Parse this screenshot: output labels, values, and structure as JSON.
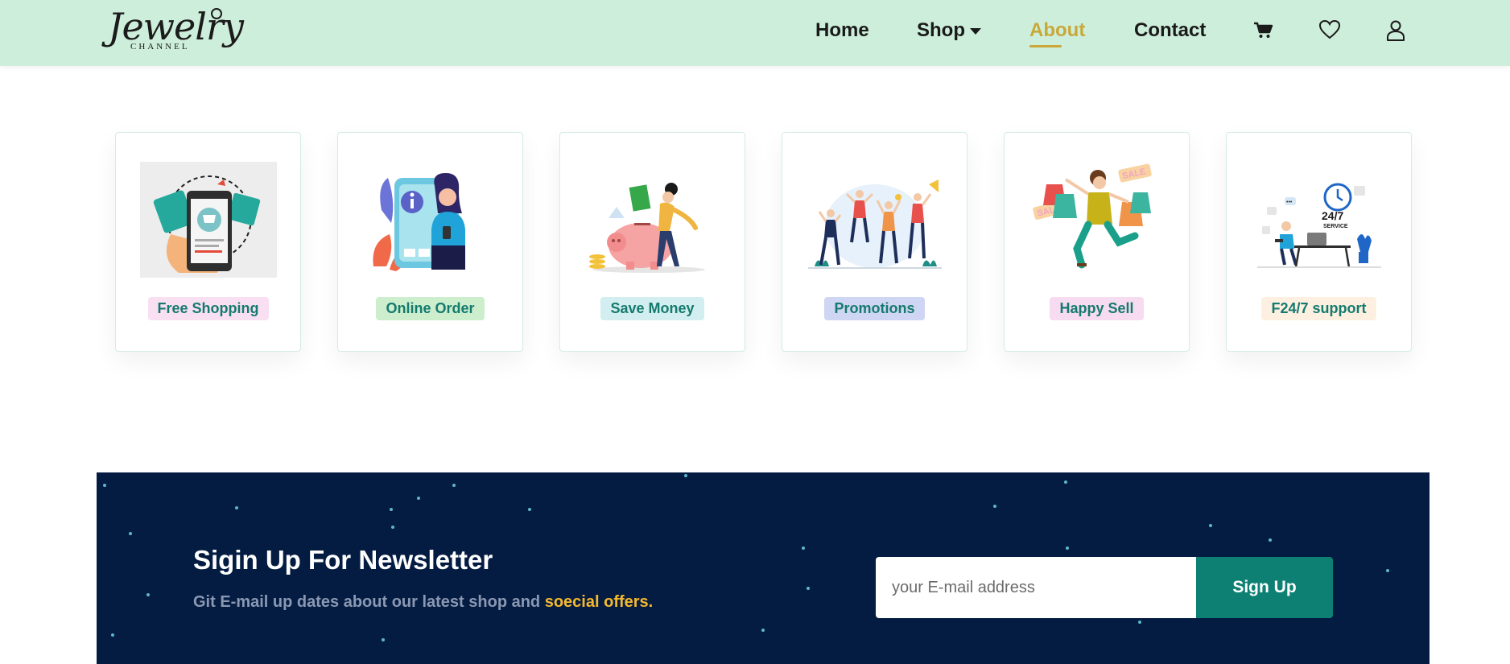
{
  "brand": {
    "logo_script": "Jewelry",
    "logo_sub": "CHANNEL"
  },
  "nav": {
    "items": [
      {
        "label": "Home"
      },
      {
        "label": "Shop"
      },
      {
        "label": "About"
      },
      {
        "label": "Contact"
      }
    ],
    "active": "About",
    "active_color": "#c9a83a",
    "icons": [
      "cart-icon",
      "heart-icon",
      "user-icon"
    ]
  },
  "features": [
    {
      "label": "Free Shopping",
      "badge_color": "#f9dff2",
      "icon": "shopping-phone-icon"
    },
    {
      "label": "Online Order",
      "badge_color": "#cdeecd",
      "icon": "online-order-icon"
    },
    {
      "label": "Save Money",
      "badge_color": "#d2eef0",
      "icon": "piggy-bank-icon"
    },
    {
      "label": "Promotions",
      "badge_color": "#cfd6f4",
      "icon": "promotions-icon"
    },
    {
      "label": "Happy Sell",
      "badge_color": "#f6dbf1",
      "icon": "happy-sell-icon"
    },
    {
      "label": "F24/7 support",
      "badge_color": "#fdf0e1",
      "icon": "support-icon"
    }
  ],
  "newsletter": {
    "title": "Sigin Up For Newsletter",
    "subtitle_plain": "Git E-mail up dates about our latest shop and ",
    "subtitle_highlight": "soecial offers.",
    "input_placeholder": "your E-mail address",
    "button_label": "Sign Up",
    "background_color": "#041c42",
    "button_color": "#0e8073",
    "highlight_color": "#f5b82e"
  }
}
